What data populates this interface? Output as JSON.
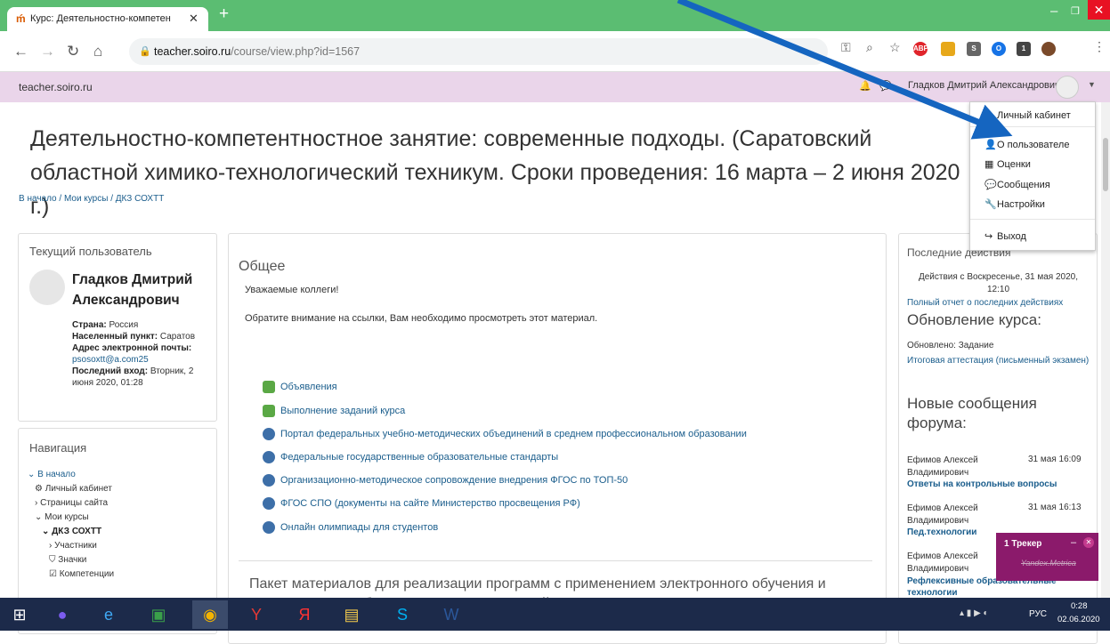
{
  "browser": {
    "tab_title": "Курс: Деятельностно-компетен",
    "url_host": "teacher.soiro.ru",
    "url_path": "/course/view.php?id=1567",
    "new_tab": "+",
    "extensions": {
      "abp": "ABP",
      "badge": "1"
    }
  },
  "header": {
    "site_name": "teacher.soiro.ru",
    "user_name": "Гладков Дмитрий Александрович"
  },
  "user_menu": {
    "items": [
      "Личный кабинет",
      "О пользователе",
      "Оценки",
      "Сообщения",
      "Настройки",
      "Выход"
    ]
  },
  "page": {
    "title": "Деятельностно-компетентностное занятие: современные подходы. (Саратовский областной химико-технологический техникум. Сроки проведения: 16 марта – 2 июня 2020 г.)",
    "breadcrumb": [
      "В начало",
      "Мои курсы",
      "ДКЗ СОХТТ"
    ]
  },
  "current_user": {
    "block_title": "Текущий пользователь",
    "name": "Гладков Дмитрий Александрович",
    "country_label": "Страна:",
    "country": "Россия",
    "city_label": "Населенный пункт:",
    "city": "Саратов",
    "email_label": "Адрес электронной почты:",
    "email": "psosoxtt@a.com25",
    "last_login_label": "Последний вход:",
    "last_login": "Вторник, 2 июня 2020, 01:28"
  },
  "navigation": {
    "block_title": "Навигация",
    "items": [
      "В начало",
      "Личный кабинет",
      "Страницы сайта",
      "Мои курсы",
      "ДКЗ СОХТТ",
      "Участники",
      "Значки",
      "Компетенции"
    ]
  },
  "course": {
    "section1_title": "Общее",
    "greeting": "Уважаемые коллеги!",
    "notice": "Обратите внимание  на ссылки, Вам необходимо просмотреть  этот материал.",
    "activities": [
      "Объявления",
      "Выполнение заданий курса",
      "Портал федеральных учебно-методических объединений в среднем профессиональном образовании",
      "Федеральные государственные образовательные стандарты",
      "Организационно-методическое сопровождение внедрения ФГОС по ТОП-50",
      "ФГОС СПО (документы на сайте Министерство просвещения РФ)",
      "Онлайн олимпиады для студентов"
    ],
    "section2_title": "Пакет материалов для реализации программ с применением электронного обучения и дистанционных образовательных технологий"
  },
  "recent": {
    "block_title": "Последние действия",
    "since": "Действия с Воскресенье, 31 мая 2020, 12:10",
    "full_report": "Полный отчет о последних действиях",
    "updates_title": "Обновление курса:",
    "updated_label": "Обновлено: Задание",
    "updated_item": "Итоговая аттестация (письменный экзамен)",
    "forum_title": "Новые сообщения форума:",
    "posts": [
      {
        "author": "Ефимов Алексей Владимирович",
        "date": "31 мая 16:09",
        "subject": "Ответы на контрольные вопросы"
      },
      {
        "author": "Ефимов Алексей Владимирович",
        "date": "31 мая 16:13",
        "subject": "Пед.технологии"
      },
      {
        "author": "Ефимов Алексей Владимирович",
        "date": "",
        "subject": "Рефлексивные образовательные технологии"
      }
    ]
  },
  "tracker": {
    "title": "1 Трекер",
    "subtitle": "Yandex.Metrica"
  },
  "taskbar": {
    "lang": "РУС",
    "time": "0:28",
    "date": "02.06.2020"
  },
  "colors": {
    "tab_bar": "#5bbd72",
    "header": "#ead5ea",
    "link": "#1a5d8c",
    "arrow": "#1565c0",
    "tracker": "#8b1a6b"
  }
}
